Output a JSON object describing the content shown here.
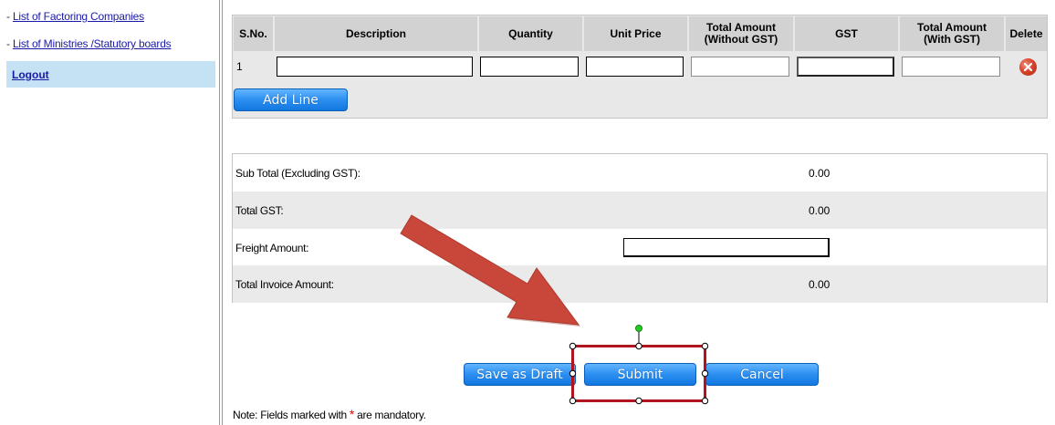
{
  "sidebar": {
    "links": [
      {
        "dash": "- ",
        "label": "List of Factoring Companies"
      },
      {
        "dash": "- ",
        "label": "List of Ministries /Statutory boards"
      }
    ],
    "logout": "Logout"
  },
  "items_table": {
    "headers": {
      "sno": "S.No.",
      "description": "Description",
      "quantity": "Quantity",
      "unit_price": "Unit Price",
      "total_wo_gst_1": "Total Amount",
      "total_wo_gst_2": "(Without GST)",
      "gst": "GST",
      "total_w_gst_1": "Total Amount",
      "total_w_gst_2": "(With GST)",
      "delete": "Delete"
    },
    "rows": [
      {
        "sno": "1",
        "description": "",
        "quantity": "",
        "unit_price": "",
        "total_wo_gst": "",
        "gst": "",
        "total_w_gst": ""
      }
    ],
    "add_line": "Add Line",
    "delete_icon": "delete-x-icon"
  },
  "totals": {
    "sub_total_label": "Sub Total (Excluding GST):",
    "sub_total_value": "0.00",
    "total_gst_label": "Total GST:",
    "total_gst_value": "0.00",
    "freight_label": "Freight Amount:",
    "freight_value": "",
    "total_invoice_label": "Total Invoice Amount:",
    "total_invoice_value": "0.00"
  },
  "actions": {
    "save_draft": "Save as Draft",
    "submit": "Submit",
    "cancel": "Cancel"
  },
  "note": {
    "prefix": "Note: Fields marked with ",
    "star": "*",
    "suffix": " are mandatory."
  },
  "colors": {
    "link": "#1a1aa8",
    "logout_bg": "#c4e2f4",
    "header_bg": "#d2d2d2",
    "button_blue": "#2b8ef0",
    "arrow": "#c0392b",
    "highlight_box": "#b0141e"
  }
}
